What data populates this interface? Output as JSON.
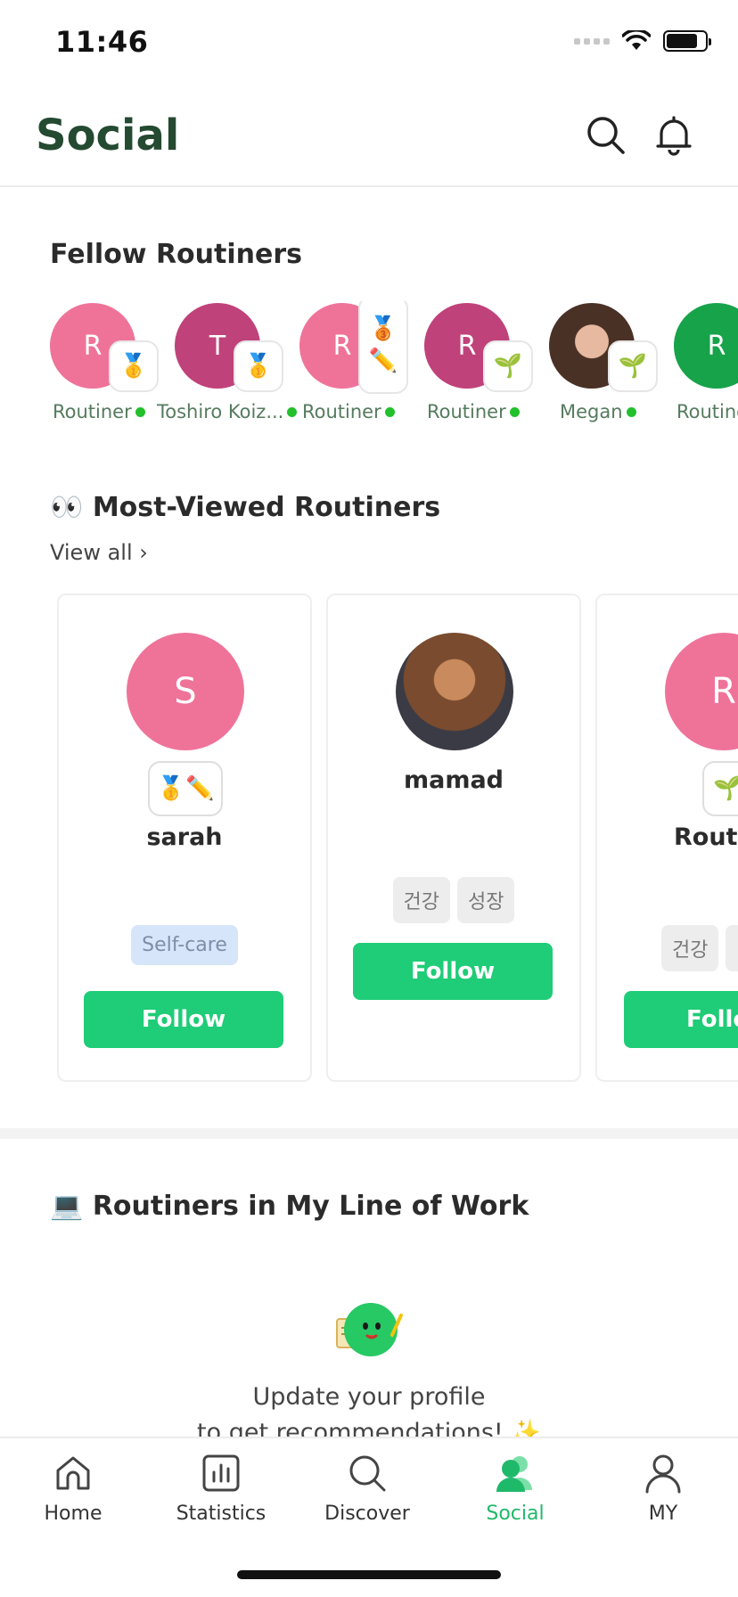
{
  "status_bar": {
    "time": "11:46"
  },
  "header": {
    "title": "Social"
  },
  "fellow_section": {
    "title": "Fellow Routiners",
    "items": [
      {
        "initial": "R",
        "name": "Routiner",
        "color": "#ef7399",
        "badge": "🥇"
      },
      {
        "initial": "T",
        "name": "Toshiro Koiz...",
        "color": "#c0427a",
        "badge": "🥇"
      },
      {
        "initial": "R",
        "name": "Routiner",
        "color": "#ef7399",
        "badge": "🥉",
        "badge2": "✏️"
      },
      {
        "initial": "R",
        "name": "Routiner",
        "color": "#c0427a",
        "badge": "🌱"
      },
      {
        "initial": "",
        "name": "Megan",
        "color": "#6b4a3a",
        "badge": "🌱"
      },
      {
        "initial": "R",
        "name": "Routine",
        "color": "#16a34a",
        "badge": ""
      }
    ]
  },
  "most_viewed": {
    "emoji": "👀",
    "title": "Most-Viewed Routiners",
    "view_all": "View all ›",
    "cards": [
      {
        "initial": "S",
        "name": "sarah",
        "color": "#ef7399",
        "badges": "🥇✏️",
        "tags": [
          "Self-care"
        ],
        "follow": "Follow"
      },
      {
        "initial": "",
        "name": "mamad",
        "color": "#5a4a3e",
        "tags": [
          "건강",
          "성장"
        ],
        "follow": "Follow"
      },
      {
        "initial": "R",
        "name": "Routir",
        "color": "#ef7399",
        "badges": "🌱",
        "tags": [
          "건강",
          ""
        ],
        "follow": "Follo"
      }
    ]
  },
  "line_of_work": {
    "emoji": "💻",
    "title": "Routiners in My Line of Work",
    "line1": "Update your profile",
    "line2": "to get recommendations! ✨"
  },
  "tabs": [
    {
      "label": "Home",
      "icon": "home-icon"
    },
    {
      "label": "Statistics",
      "icon": "statistics-icon"
    },
    {
      "label": "Discover",
      "icon": "search-icon"
    },
    {
      "label": "Social",
      "icon": "social-icon",
      "active": true
    },
    {
      "label": "MY",
      "icon": "profile-icon"
    }
  ],
  "colors": {
    "accent": "#1fcc77",
    "title": "#244a31",
    "active_tab": "#1fb96a"
  }
}
